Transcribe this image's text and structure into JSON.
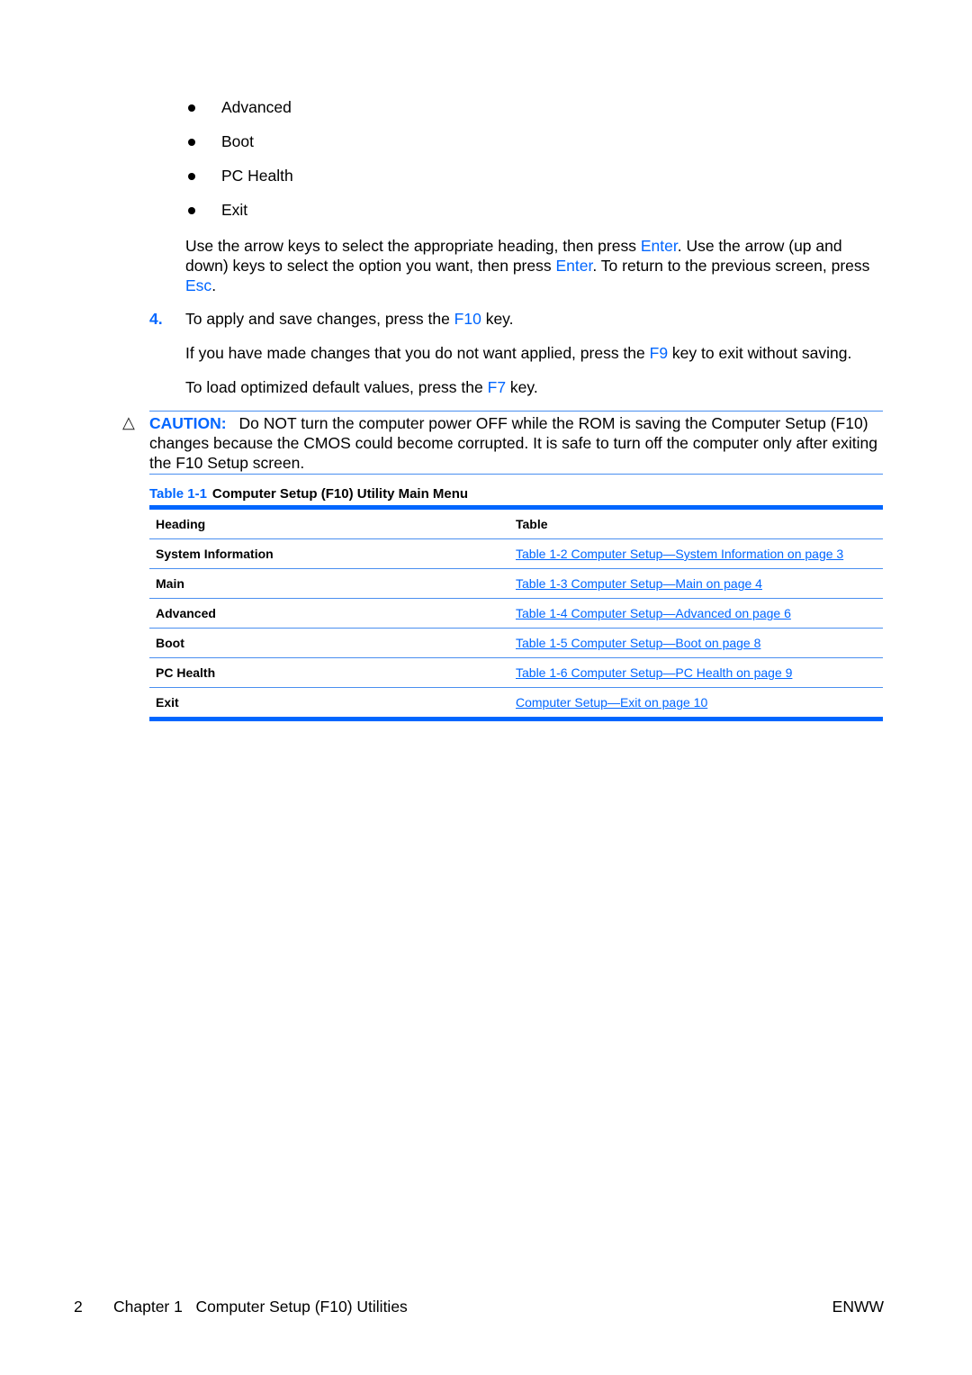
{
  "bullets": [
    "Advanced",
    "Boot",
    "PC Health",
    "Exit"
  ],
  "nav_paragraph": {
    "t1": "Use the arrow keys to select the appropriate heading, then press ",
    "k1": "Enter",
    "t2": ". Use the arrow (up and down) keys to select the option you want, then press ",
    "k2": "Enter",
    "t3": ". To return to the previous screen, press ",
    "k3": "Esc",
    "t4": "."
  },
  "step4": {
    "number": "4.",
    "t1": "To apply and save changes, press the ",
    "key": "F10",
    "t2": " key."
  },
  "discard_paragraph": {
    "t1": "If you have made changes that you do not want applied, press the ",
    "key": "F9",
    "t2": " key to exit without saving."
  },
  "defaults_paragraph": {
    "t1": "To load optimized default values, press the ",
    "key": "F7",
    "t2": " key."
  },
  "caution": {
    "icon": "warning-triangle-icon",
    "label": "CAUTION:",
    "text": "Do NOT turn the computer power OFF while the ROM is saving the Computer Setup (F10) changes because the CMOS could become corrupted. It is safe to turn off the computer only after exiting the F10 Setup screen."
  },
  "table": {
    "caption_number": "Table 1-1",
    "caption_title": "Computer Setup (F10) Utility Main Menu",
    "headers": [
      "Heading",
      "Table"
    ],
    "rows": [
      {
        "heading": "System Information",
        "link": "Table 1-2 Computer Setup—System Information on page 3"
      },
      {
        "heading": "Main",
        "link": "Table 1-3 Computer Setup—Main on page 4"
      },
      {
        "heading": "Advanced",
        "link": "Table 1-4 Computer Setup—Advanced on page 6"
      },
      {
        "heading": "Boot",
        "link": "Table 1-5 Computer Setup—Boot on page 8"
      },
      {
        "heading": "PC Health",
        "link": "Table 1-6 Computer Setup—PC Health on page 9"
      },
      {
        "heading": "Exit",
        "link": "Computer Setup—Exit on page 10"
      }
    ]
  },
  "footer": {
    "page_number": "2",
    "chapter": "Chapter 1   Computer Setup (F10) Utilities",
    "right": "ENWW"
  },
  "colors": {
    "accent": "#0066ff",
    "rule": "#4a8ff0"
  }
}
